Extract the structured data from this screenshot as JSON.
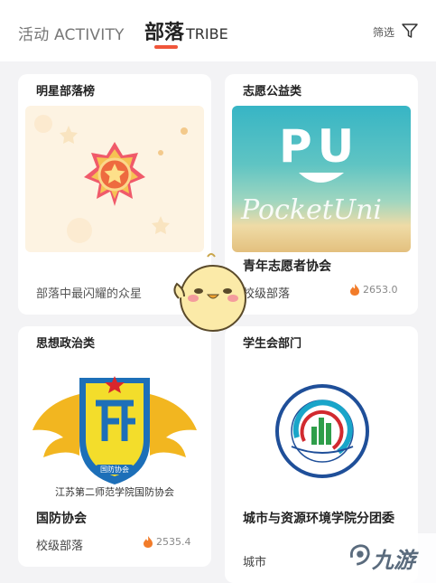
{
  "header": {
    "tab_activity": "活动 ACTIVITY",
    "tab_tribe_cn": "部落",
    "tab_tribe_en": "TRIBE",
    "filter_label": "筛选",
    "filter_icon": "filter-funnel-icon",
    "accent_color": "#f0553a"
  },
  "cards": [
    {
      "category": "明星部落榜",
      "subtitle": "部落中最闪耀的众星"
    },
    {
      "category": "志愿公益类",
      "banner_text_top": "PU",
      "banner_text_bottom": "PocketUni",
      "name": "青年志愿者协会",
      "level": "校级部落",
      "heat": "2653.0"
    },
    {
      "category": "思想政治类",
      "logo_caption": "江苏第二师范学院国防协会",
      "logo_badge_text": "国防协会",
      "name": "国防协会",
      "level": "校级部落",
      "heat": "2535.4"
    },
    {
      "category": "学生会部门",
      "name": "城市与资源环境学院分团委",
      "level": "城市"
    }
  ],
  "watermark": {
    "text": "九游"
  }
}
